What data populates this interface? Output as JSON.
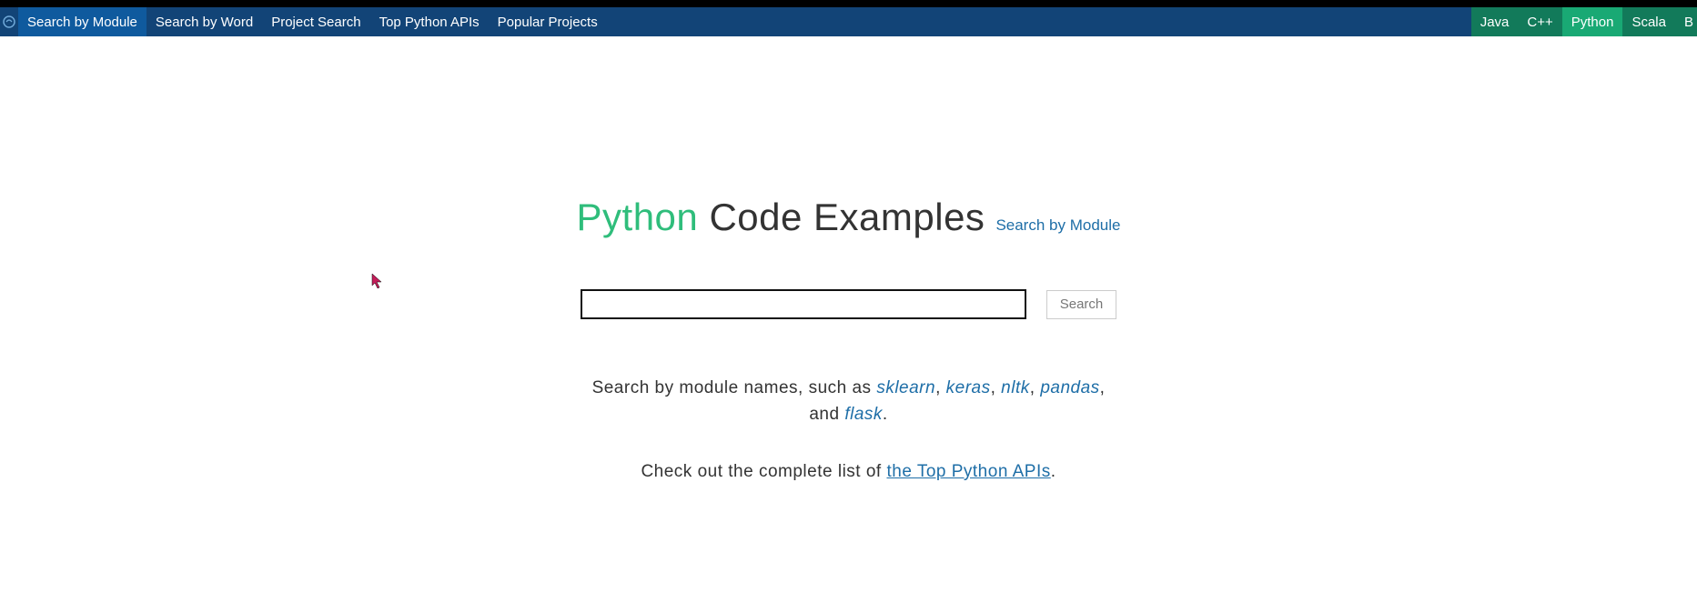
{
  "nav": {
    "left_items": [
      {
        "label": "Search by Module",
        "active": true
      },
      {
        "label": "Search by Word",
        "active": false
      },
      {
        "label": "Project Search",
        "active": false
      },
      {
        "label": "Top Python APIs",
        "active": false
      },
      {
        "label": "Popular Projects",
        "active": false
      }
    ],
    "languages": [
      {
        "label": "Java",
        "active": false
      },
      {
        "label": "C++",
        "active": false
      },
      {
        "label": "Python",
        "active": true
      },
      {
        "label": "Scala",
        "active": false
      },
      {
        "label": "B",
        "active": false,
        "partial": true
      }
    ]
  },
  "title": {
    "accent": "Python",
    "rest": " Code Examples",
    "subtitle_link": "Search by Module"
  },
  "search": {
    "value": "",
    "placeholder": "",
    "button_label": "Search"
  },
  "hint": {
    "prefix": "Search by module names, such as ",
    "modules": [
      "sklearn",
      "keras",
      "nltk",
      "pandas",
      "flask"
    ],
    "and_word": ", and "
  },
  "apis": {
    "prefix": "Check out the complete list of ",
    "link": "the Top Python APIs"
  }
}
